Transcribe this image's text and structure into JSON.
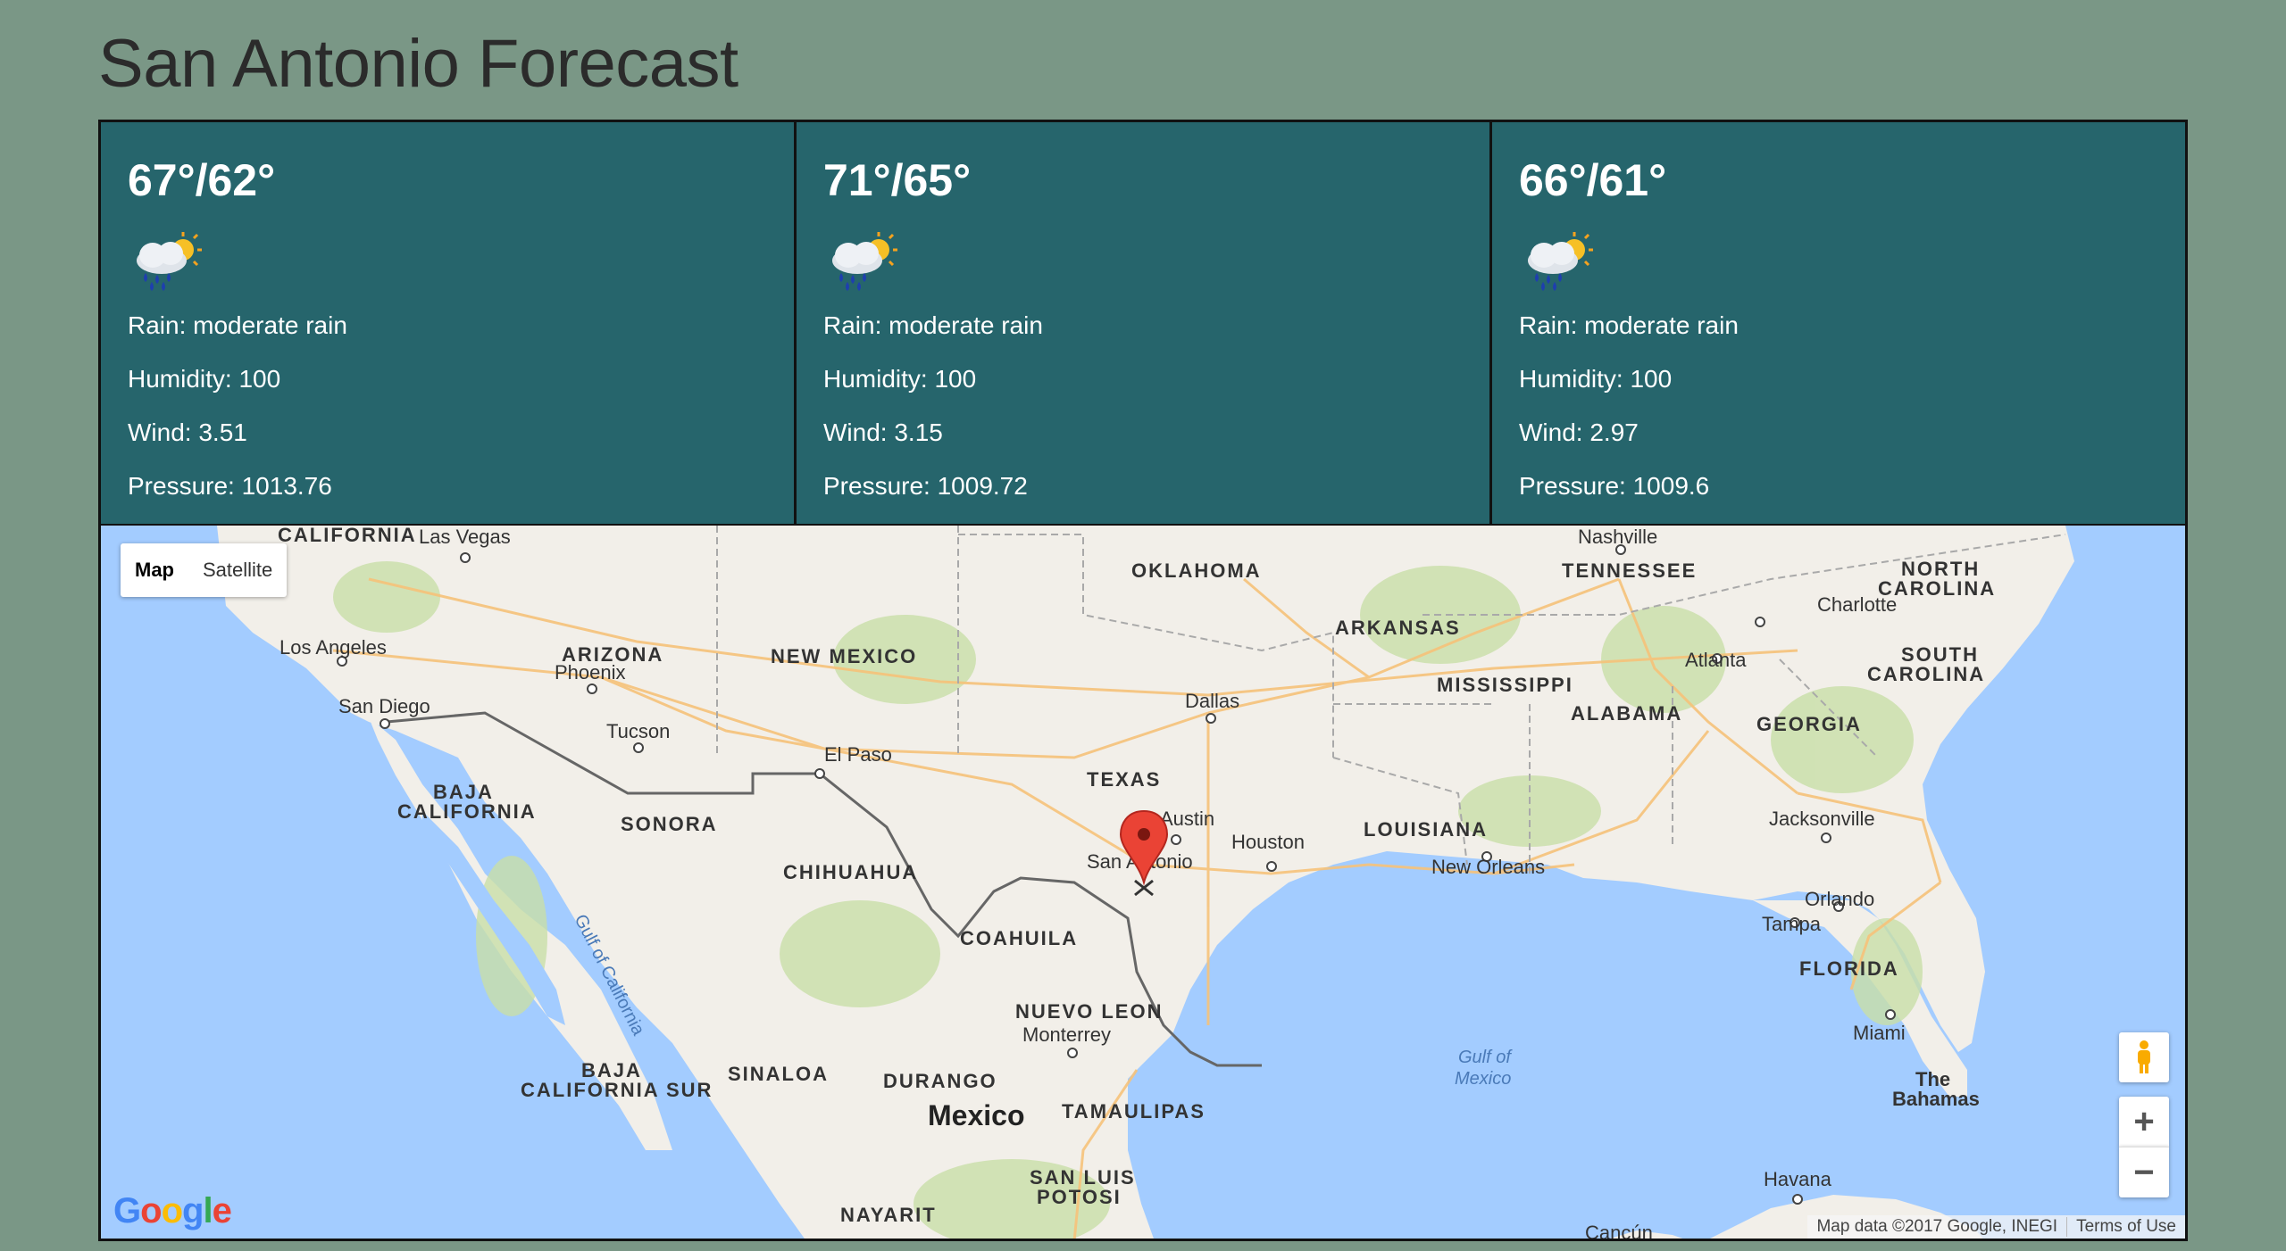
{
  "page": {
    "title": "San Antonio Forecast"
  },
  "forecast": [
    {
      "temp": "67°/62°",
      "icon": "rain-sun-icon",
      "rain": "Rain: moderate rain",
      "humidity": "Humidity: 100",
      "wind": "Wind: 3.51",
      "pressure": "Pressure: 1013.76"
    },
    {
      "temp": "71°/65°",
      "icon": "rain-sun-icon",
      "rain": "Rain: moderate rain",
      "humidity": "Humidity: 100",
      "wind": "Wind: 3.15",
      "pressure": "Pressure: 1009.72"
    },
    {
      "temp": "66°/61°",
      "icon": "rain-sun-icon",
      "rain": "Rain: moderate rain",
      "humidity": "Humidity: 100",
      "wind": "Wind: 2.97",
      "pressure": "Pressure: 1009.6"
    }
  ],
  "map": {
    "type_control": {
      "map_label": "Map",
      "satellite_label": "Satellite"
    },
    "zoom_in": "+",
    "zoom_out": "−",
    "attribution": "Map data ©2017 Google, INEGI",
    "terms": "Terms of Use",
    "logo": "Google",
    "labels": {
      "california": "CALIFORNIA",
      "las_vegas": "Las Vegas",
      "oklahoma": "OKLAHOMA",
      "nashville": "Nashville",
      "tennessee": "TENNESSEE",
      "north_carolina_1": "NORTH",
      "north_carolina_2": "CAROLINA",
      "charlotte": "Charlotte",
      "los_angeles": "Los Angeles",
      "arizona": "ARIZONA",
      "phoenix": "Phoenix",
      "new_mexico": "NEW MEXICO",
      "arkansas": "ARKANSAS",
      "atlanta": "Atlanta",
      "south_carolina_1": "SOUTH",
      "south_carolina_2": "CAROLINA",
      "mississippi": "MISSISSIPPI",
      "san_diego": "San Diego",
      "dallas": "Dallas",
      "alabama": "ALABAMA",
      "georgia": "GEORGIA",
      "tucson": "Tucson",
      "el_paso": "El Paso",
      "texas": "TEXAS",
      "baja_california_1": "BAJA",
      "baja_california_2": "CALIFORNIA",
      "austin": "Austin",
      "houston": "Houston",
      "louisiana": "LOUISIANA",
      "jacksonville": "Jacksonville",
      "sonora": "SONORA",
      "san_antonio": "San Antonio",
      "new_orleans": "New Orleans",
      "chihuahua": "CHIHUAHUA",
      "gulf_of_california": "Gulf of California",
      "orlando": "Orlando",
      "tampa": "Tampa",
      "coahuila": "COAHUILA",
      "florida": "FLORIDA",
      "nuevo_leon": "NUEVO LEON",
      "monterrey": "Monterrey",
      "miami": "Miami",
      "gulf_of_mexico_1": "Gulf of",
      "gulf_of_mexico_2": "Mexico",
      "baja_california_sur_1": "BAJA",
      "baja_california_sur_2": "CALIFORNIA SUR",
      "sinaloa": "SINALOA",
      "durango": "DURANGO",
      "the_bahamas_1": "The",
      "the_bahamas_2": "Bahamas",
      "mexico": "Mexico",
      "tamaulipas": "TAMAULIPAS",
      "havana": "Havana",
      "san_luis_potosi_1": "SAN LUIS",
      "san_luis_potosi_2": "POTOSI",
      "nayarit": "NAYARIT",
      "cancun": "Cancún"
    }
  },
  "colors": {
    "page_background": "#7a9786",
    "card_background": "#26656c",
    "water": "#a3ccff",
    "land": "#f2efe9",
    "marker": "#ea4335"
  }
}
